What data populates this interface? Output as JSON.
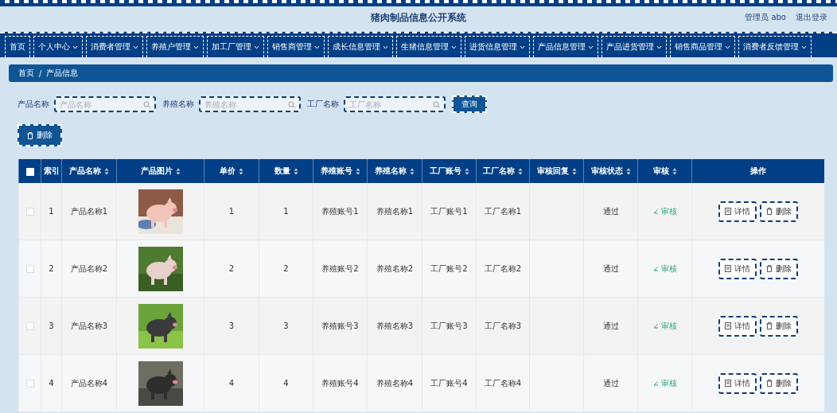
{
  "header": {
    "title": "猪肉制品信息公开系统",
    "user": "管理员 abo",
    "logout": "退出登录"
  },
  "nav": [
    {
      "label": "首页",
      "dropdown": false
    },
    {
      "label": "个人中心",
      "dropdown": true
    },
    {
      "label": "消费者管理",
      "dropdown": true
    },
    {
      "label": "养殖户管理",
      "dropdown": true
    },
    {
      "label": "加工厂管理",
      "dropdown": true
    },
    {
      "label": "销售商管理",
      "dropdown": true
    },
    {
      "label": "成长信息管理",
      "dropdown": true
    },
    {
      "label": "生猪信息管理",
      "dropdown": true
    },
    {
      "label": "进货信息管理",
      "dropdown": true
    },
    {
      "label": "产品信息管理",
      "dropdown": true
    },
    {
      "label": "产品进货管理",
      "dropdown": true
    },
    {
      "label": "销售商品管理",
      "dropdown": true
    },
    {
      "label": "消费者反馈管理",
      "dropdown": true
    }
  ],
  "breadcrumb": [
    "首页",
    "/",
    "产品信息"
  ],
  "search": {
    "fields": [
      {
        "label": "产品名称",
        "placeholder": "产品名称"
      },
      {
        "label": "养殖名称",
        "placeholder": "养殖名称"
      },
      {
        "label": "工厂名称",
        "placeholder": "工厂名称"
      }
    ],
    "button": "查询"
  },
  "delete_button": "删除",
  "table": {
    "select_all_checked": false,
    "columns": [
      {
        "label": "索引",
        "sortable": false
      },
      {
        "label": "产品名称",
        "sortable": true
      },
      {
        "label": "产品图片",
        "sortable": true
      },
      {
        "label": "单价",
        "sortable": true
      },
      {
        "label": "数量",
        "sortable": true
      },
      {
        "label": "养殖账号",
        "sortable": true
      },
      {
        "label": "养殖名称",
        "sortable": true
      },
      {
        "label": "工厂账号",
        "sortable": true
      },
      {
        "label": "工厂名称",
        "sortable": true
      },
      {
        "label": "审核回复",
        "sortable": true
      },
      {
        "label": "审核状态",
        "sortable": true
      },
      {
        "label": "审核",
        "sortable": true
      },
      {
        "label": "操作",
        "sortable": false
      }
    ],
    "rows": [
      {
        "checked": false,
        "index": "1",
        "name": "产品名称1",
        "picture": {
          "kind": "picture"
        },
        "price": "1",
        "quantity": "1",
        "farm_account": "养殖账号1",
        "farm_name": "养殖名称1",
        "factory_account": "工厂账号1",
        "factory_name": "工厂名称1",
        "status": "通过",
        "review": "审核",
        "actions": [
          "详情",
          "删除"
        ]
      },
      {
        "checked": false,
        "index": "2",
        "name": "产品名称2",
        "picture": {
          "kind": "picture"
        },
        "price": "2",
        "quantity": "2",
        "farm_account": "养殖账号2",
        "farm_name": "养殖名称2",
        "factory_account": "工厂账号2",
        "factory_name": "工厂名称2",
        "status": "通过",
        "review": "审核",
        "actions": [
          "详情",
          "删除"
        ]
      },
      {
        "checked": false,
        "index": "3",
        "name": "产品名称3",
        "picture": {
          "kind": "picture"
        },
        "price": "3",
        "quantity": "3",
        "farm_account": "养殖账号3",
        "farm_name": "养殖名称3",
        "factory_account": "工厂账号3",
        "factory_name": "工厂名称3",
        "status": "通过",
        "review": "审核",
        "actions": [
          "详情",
          "删除"
        ]
      },
      {
        "checked": false,
        "index": "4",
        "name": "产品名称4",
        "picture": {
          "kind": "picture"
        },
        "price": "4",
        "quantity": "4",
        "farm_account": "养殖账号4",
        "farm_name": "养殖名称4",
        "factory_account": "工厂账号4",
        "factory_name": "工厂名称4",
        "status": "通过",
        "review": "审核",
        "actions": [
          "详情",
          "删除"
        ]
      }
    ]
  }
}
